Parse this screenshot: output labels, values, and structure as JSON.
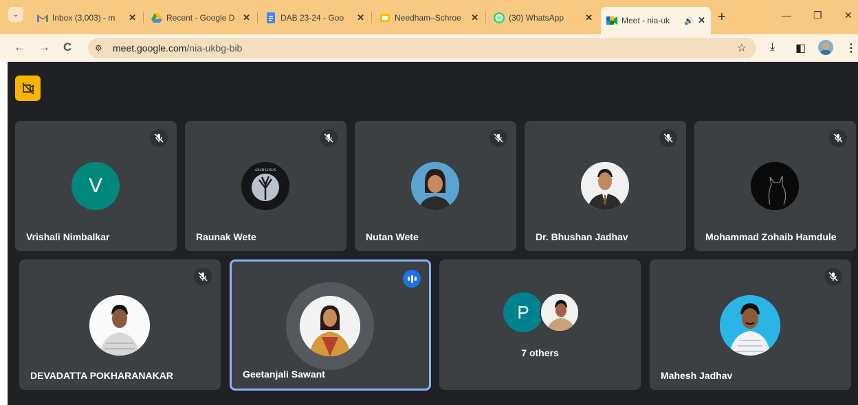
{
  "browser": {
    "tabs": [
      {
        "title": "Inbox (3,003) - m",
        "favicon": "gmail-icon"
      },
      {
        "title": "Recent - Google D",
        "favicon": "drive-icon"
      },
      {
        "title": "DAB 23-24 - Goo",
        "favicon": "docs-icon"
      },
      {
        "title": "Needham–Schroe",
        "favicon": "slides-icon"
      },
      {
        "title": "(30) WhatsApp",
        "favicon": "whatsapp-icon",
        "badge": "30"
      },
      {
        "title": "Meet - nia-uk",
        "favicon": "meet-icon",
        "active": true
      }
    ],
    "url_host": "meet.google.com",
    "url_path": "/nia-ukbg-bib"
  },
  "meet": {
    "row1": [
      {
        "name": "Vrishali Nimbalkar",
        "avatar_letter": "V",
        "avatar_color": "#00897b",
        "muted": true
      },
      {
        "name": "Raunak Wete",
        "muted": true
      },
      {
        "name": "Nutan Wete",
        "muted": true
      },
      {
        "name": "Dr. Bhushan Jadhav",
        "muted": true
      },
      {
        "name": "Mohammad Zohaib Hamdule",
        "muted": true
      }
    ],
    "row2": [
      {
        "name": "DEVADATTA POKHARANAKAR",
        "muted": true
      },
      {
        "name": "Geetanjali Sawant",
        "speaking": true
      },
      {
        "name": "7 others",
        "avatar_letter": "P",
        "avatar_color": "#00838f"
      },
      {
        "name": "Mahesh Jadhav",
        "muted": true
      }
    ],
    "raunak_avatar_text": "ARCH LINUX",
    "colors": {
      "background": "#202124",
      "tile": "#3c4043",
      "accent": "#8ab4f8",
      "camera_button": "#f9b400"
    }
  }
}
